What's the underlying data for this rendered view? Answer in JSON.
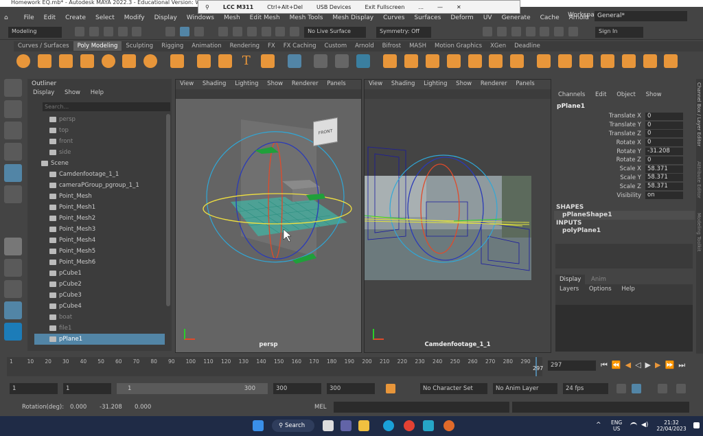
{
  "window_title": "Homework EQ.mb* - Autodesk MAYA 2022.3 - Educational Version: W:\\2204",
  "rdp_bar": {
    "pin": "⚲",
    "host": "LCC M311",
    "cad": "Ctrl+Alt+Del",
    "usb": "USB Devices",
    "exit": "Exit Fullscreen",
    "more": "...",
    "minimize": "—",
    "close": "✕"
  },
  "menu": [
    "File",
    "Edit",
    "Create",
    "Select",
    "Modify",
    "Display",
    "Windows",
    "Mesh",
    "Edit Mesh",
    "Mesh Tools",
    "Mesh Display",
    "Curves",
    "Surfaces",
    "Deform",
    "UV",
    "Generate",
    "Cache",
    "Arnold",
    "Help"
  ],
  "workspace_label": "Workspace:",
  "workspace_value": "General*",
  "mode_value": "Modeling",
  "live_surface": "No Live Surface",
  "symmetry": "Symmetry: Off",
  "sign_in": "Sign In",
  "shelf_tabs": [
    "Curves / Surfaces",
    "Poly Modeling",
    "Sculpting",
    "Rigging",
    "Animation",
    "Rendering",
    "FX",
    "FX Caching",
    "Custom",
    "Arnold",
    "Bifrost",
    "MASH",
    "Motion Graphics",
    "XGen",
    "Deadline"
  ],
  "shelf_active": "Poly Modeling",
  "outliner": {
    "title": "Outliner",
    "menu": [
      "Display",
      "Show",
      "Help"
    ],
    "search_placeholder": "Search...",
    "items": [
      {
        "label": "persp",
        "dim": true,
        "indent": 1
      },
      {
        "label": "top",
        "dim": true,
        "indent": 1
      },
      {
        "label": "front",
        "dim": true,
        "indent": 1
      },
      {
        "label": "side",
        "dim": true,
        "indent": 1
      },
      {
        "label": "Scene",
        "dim": false,
        "indent": 0
      },
      {
        "label": "Camdenfootage_1_1",
        "dim": false,
        "indent": 1
      },
      {
        "label": "cameraPGroup_pgroup_1_1",
        "dim": false,
        "indent": 1
      },
      {
        "label": "Point_Mesh",
        "dim": false,
        "indent": 1
      },
      {
        "label": "Point_Mesh1",
        "dim": false,
        "indent": 1
      },
      {
        "label": "Point_Mesh2",
        "dim": false,
        "indent": 1
      },
      {
        "label": "Point_Mesh3",
        "dim": false,
        "indent": 1
      },
      {
        "label": "Point_Mesh4",
        "dim": false,
        "indent": 1
      },
      {
        "label": "Point_Mesh5",
        "dim": false,
        "indent": 1
      },
      {
        "label": "Point_Mesh6",
        "dim": false,
        "indent": 1
      },
      {
        "label": "pCube1",
        "dim": false,
        "indent": 1
      },
      {
        "label": "pCube2",
        "dim": false,
        "indent": 1
      },
      {
        "label": "pCube3",
        "dim": false,
        "indent": 1
      },
      {
        "label": "pCube4",
        "dim": false,
        "indent": 1
      },
      {
        "label": "boat",
        "dim": true,
        "indent": 1
      },
      {
        "label": "file1",
        "dim": true,
        "indent": 1
      },
      {
        "label": "pPlane1",
        "dim": false,
        "indent": 1,
        "selected": true
      }
    ]
  },
  "viewport_menu": [
    "View",
    "Shading",
    "Lighting",
    "Show",
    "Renderer",
    "Panels"
  ],
  "viewport_left_label": "persp",
  "viewport_right_label": "Camdenfootage_1_1",
  "viewcube_label": "FRONT",
  "channel_box": {
    "menu": [
      "Channels",
      "Edit",
      "Object",
      "Show"
    ],
    "object": "pPlane1",
    "attrs": [
      {
        "name": "Translate X",
        "value": "0"
      },
      {
        "name": "Translate Y",
        "value": "0"
      },
      {
        "name": "Translate Z",
        "value": "0"
      },
      {
        "name": "Rotate X",
        "value": "0"
      },
      {
        "name": "Rotate Y",
        "value": "-31.208"
      },
      {
        "name": "Rotate Z",
        "value": "0"
      },
      {
        "name": "Scale X",
        "value": "58.371"
      },
      {
        "name": "Scale Y",
        "value": "58.371"
      },
      {
        "name": "Scale Z",
        "value": "58.371"
      },
      {
        "name": "Visibility",
        "value": "on"
      }
    ],
    "shapes_header": "SHAPES",
    "shape": "pPlaneShape1",
    "inputs_header": "INPUTS",
    "input": "polyPlane1"
  },
  "layer_editor": {
    "tabs": [
      "Display",
      "Anim"
    ],
    "menu": [
      "Layers",
      "Options",
      "Help"
    ]
  },
  "side_tabs": [
    "Channel Box / Layer Editor",
    "Attribute Editor",
    "Modeling Toolkit"
  ],
  "timeline": {
    "ticks": [
      "1",
      "10",
      "20",
      "30",
      "40",
      "50",
      "60",
      "70",
      "80",
      "90",
      "100",
      "110",
      "120",
      "130",
      "140",
      "150",
      "160",
      "170",
      "180",
      "190",
      "200",
      "210",
      "220",
      "230",
      "240",
      "250",
      "260",
      "270",
      "280",
      "290"
    ],
    "current_frame": "297",
    "current_box": "297"
  },
  "range": {
    "start": "1",
    "start2": "1",
    "slider_start": "1",
    "slider_end": "300",
    "end": "300",
    "end2": "300",
    "character_set": "No Character Set",
    "anim_layer": "No Anim Layer",
    "fps": "24 fps"
  },
  "command": {
    "rotation_label": "Rotation(deg):",
    "rx": "0.000",
    "ry": "-31.208",
    "rz": "0.000",
    "lang": "MEL"
  },
  "taskbar": {
    "search": "Search",
    "lang": "ENG",
    "region": "US",
    "time": "21:32",
    "date": "22/04/2023"
  },
  "colors": {
    "accent": "#5285a6",
    "orange_icon": "#e8963a",
    "yellow_icon": "#f0c040",
    "taskbar": "#1f2b46"
  }
}
